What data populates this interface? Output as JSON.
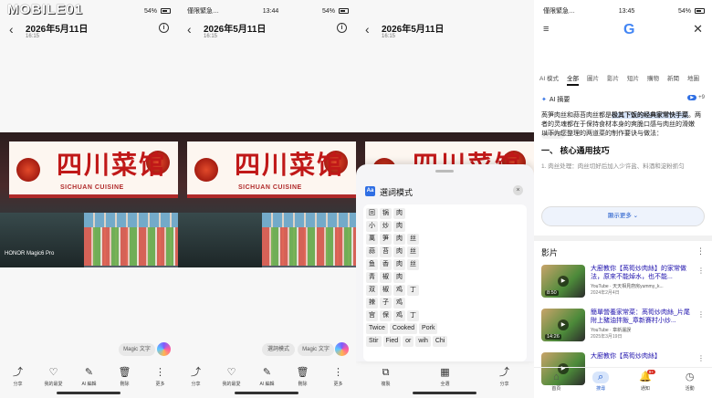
{
  "watermark": "MOBILE01",
  "status": {
    "carrier": "僅限緊急…",
    "time": "13:44",
    "time4": "13:45",
    "battery": "54%"
  },
  "photo_screens": {
    "title": "2026年5月11日",
    "subtitle": "16:15",
    "sign_cn": "四川菜馆",
    "sign_en": "SICHUAN CUISINE",
    "camera_watermark": "HONOR Magic6 Pro",
    "magic_text": "Magic 文字",
    "select_mode": "選詞模式"
  },
  "toolbar": [
    {
      "label": "分享",
      "icon": "share-icon"
    },
    {
      "label": "我的最愛",
      "icon": "heart-icon"
    },
    {
      "label": "AI 編輯",
      "icon": "ai-edit-icon"
    },
    {
      "label": "刪除",
      "icon": "trash-icon"
    },
    {
      "label": "更多",
      "icon": "more-icon"
    }
  ],
  "sheet": {
    "title": "選詞模式",
    "rows": [
      [
        "回",
        "锅",
        "肉"
      ],
      [
        "小",
        "炒",
        "肉"
      ],
      [
        "萬",
        "笋",
        "肉",
        "丝"
      ],
      [
        "蒜",
        "苔",
        "肉",
        "丝"
      ],
      [
        "鱼",
        "香",
        "肉",
        "丝"
      ],
      [
        "青",
        "椒",
        "肉"
      ],
      [
        "双",
        "椒",
        "鸡",
        "丁"
      ],
      [
        "辣",
        "子",
        "鸡"
      ],
      [
        "宫",
        "保",
        "鸡",
        "丁"
      ],
      [
        "Twice",
        "Cooked",
        "Pork"
      ],
      [
        "Stir",
        "Fied",
        "or",
        "wih",
        "Chi"
      ]
    ]
  },
  "sheet_toolbar": [
    {
      "label": "複製",
      "icon": "copy-icon"
    },
    {
      "label": "全選",
      "icon": "select-all-icon"
    },
    {
      "label": "分享",
      "icon": "share-icon"
    }
  ],
  "google": {
    "tabs": [
      "AI 模式",
      "全部",
      "圖片",
      "影片",
      "短片",
      "購物",
      "新聞",
      "地圖"
    ],
    "active_tab": "全部",
    "ai_label": "AI 摘要",
    "ai_sources": "+9",
    "ai_para1_a": "萵笋肉丝和蒜苔肉丝都是",
    "ai_para1_hl": "极其下饭的经典家常快手菜",
    "ai_para1_b": "。两者的灵魂都在于保持食材本身的爽脆口感与肉丝的滑嫩",
    "ai_source_chip": "Bilibili +1",
    "ai_para2": "以下为您整理的两道菜的制作要诀与做法：",
    "heading": "一、 核心通用技巧",
    "faded": "1. 肉丝处理：肉丝切好后加入少许盐、料酒和淀粉抓匀",
    "show_more": "顯示更多",
    "videos_label": "影片",
    "videos": [
      {
        "title": "大廚教你【萵筍炒肉絲】的家常做法，原來不能焯水，也不能...",
        "source": "YouTube · 天天相見廚房yummy_k...",
        "date": "2024年2月4日",
        "duration": "8:50"
      },
      {
        "title": "簡單營養家常菜：萵筍炒肉絲_片尾附上豬油拌飯_章新賽村小炒...",
        "source": "YouTube · 章新灑誤",
        "date": "2025年3月19日",
        "duration": "14:26"
      },
      {
        "title": "大廚教你【萵筍炒肉絲】",
        "source": "",
        "date": "",
        "duration": ""
      }
    ]
  },
  "google_nav": [
    {
      "label": "首頁",
      "icon": "home-icon"
    },
    {
      "label": "搜尋",
      "icon": "search-icon"
    },
    {
      "label": "通知",
      "icon": "bell-icon",
      "badge": "9+"
    },
    {
      "label": "活動",
      "icon": "activity-icon"
    }
  ]
}
